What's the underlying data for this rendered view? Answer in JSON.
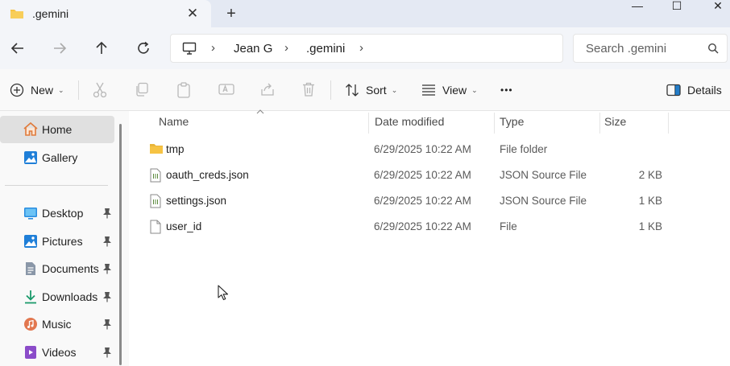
{
  "window": {
    "tab_title": ".gemini",
    "tab_close": "✕",
    "new_tab": "+",
    "minimize": "—",
    "maximize": "☐",
    "close": "✕"
  },
  "address": {
    "separator": "›",
    "crumbs": [
      "Jean G",
      ".gemini"
    ],
    "search_placeholder": "Search .gemini"
  },
  "commands": {
    "new_label": "New",
    "sort_label": "Sort",
    "view_label": "View",
    "more_label": "•••",
    "details_label": "Details",
    "chevron": "⌄"
  },
  "sidebar": {
    "items": [
      {
        "label": "Home",
        "icon": "home-icon",
        "selected": true
      },
      {
        "label": "Gallery",
        "icon": "gallery-icon"
      },
      {
        "label": "Desktop",
        "icon": "desktop-icon",
        "pinned": true
      },
      {
        "label": "Pictures",
        "icon": "pictures-icon",
        "pinned": true
      },
      {
        "label": "Documents",
        "icon": "documents-icon",
        "pinned": true
      },
      {
        "label": "Downloads",
        "icon": "downloads-icon",
        "pinned": true
      },
      {
        "label": "Music",
        "icon": "music-icon",
        "pinned": true
      },
      {
        "label": "Videos",
        "icon": "videos-icon",
        "pinned": true
      }
    ]
  },
  "columns": {
    "name": "Name",
    "date": "Date modified",
    "type": "Type",
    "size": "Size"
  },
  "files": [
    {
      "name": "tmp",
      "date": "6/29/2025 10:22 AM",
      "type": "File folder",
      "size": "",
      "icon": "folder-icon"
    },
    {
      "name": "oauth_creds.json",
      "date": "6/29/2025 10:22 AM",
      "type": "JSON Source File",
      "size": "2 KB",
      "icon": "json-file-icon"
    },
    {
      "name": "settings.json",
      "date": "6/29/2025 10:22 AM",
      "type": "JSON Source File",
      "size": "1 KB",
      "icon": "json-file-icon"
    },
    {
      "name": "user_id",
      "date": "6/29/2025 10:22 AM",
      "type": "File",
      "size": "1 KB",
      "icon": "file-icon"
    }
  ],
  "colors": {
    "folder": "#f6c343",
    "accent": "#0067c0",
    "selected_bg": "#e0e0e0"
  }
}
